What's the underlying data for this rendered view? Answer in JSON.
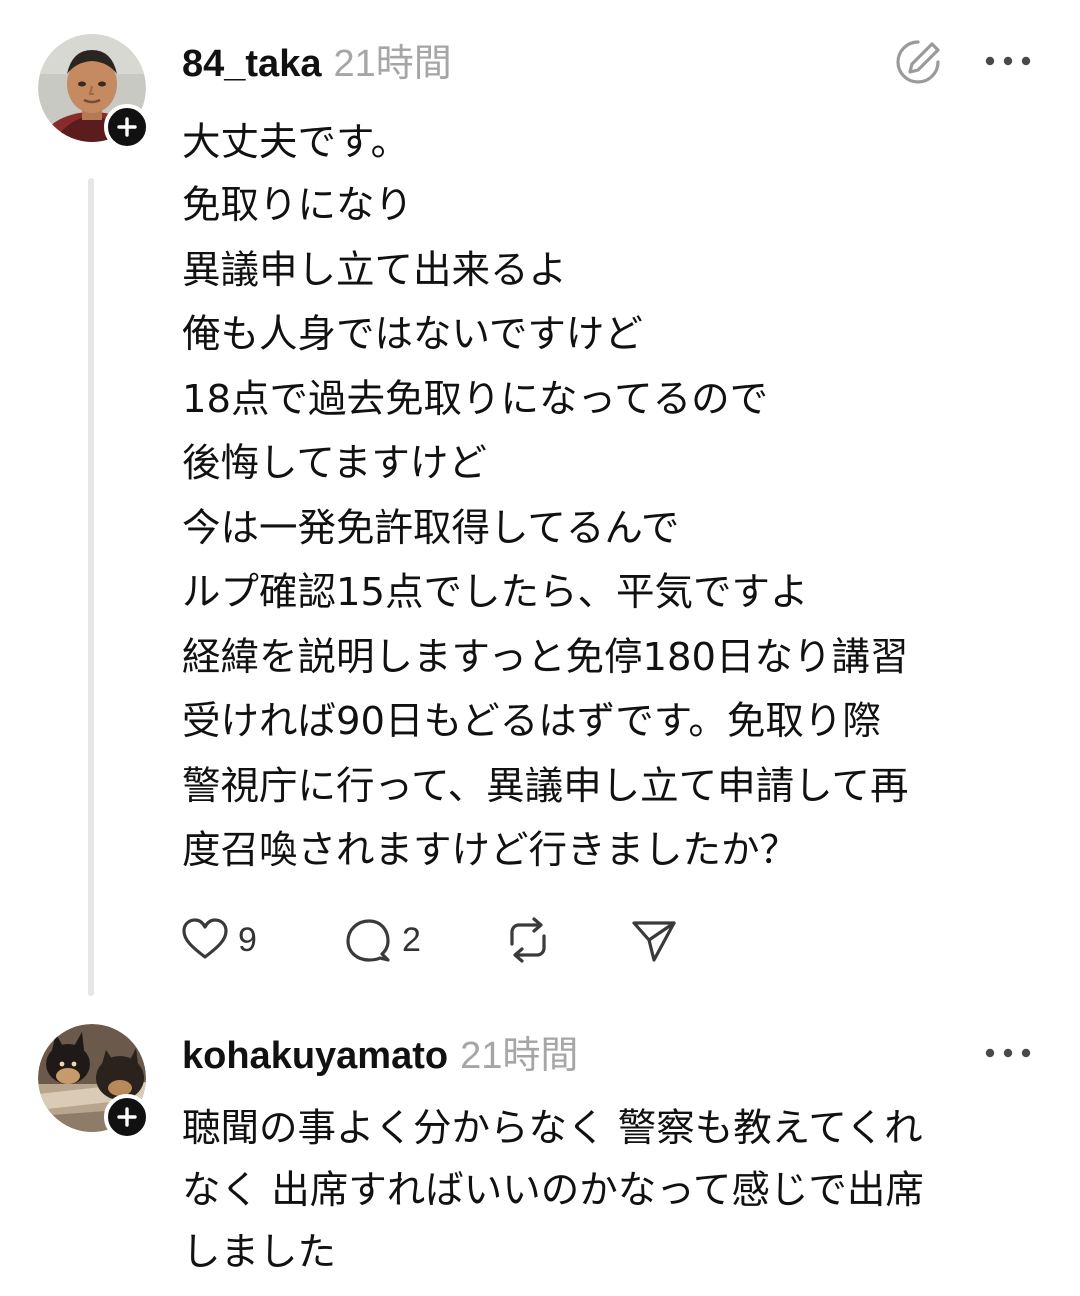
{
  "posts": [
    {
      "username": "84_taka",
      "timestamp": "21時間",
      "body_lines": [
        "大丈夫です。",
        "免取りになり",
        "異議申し立て出来るよ",
        "俺も人身ではないですけど",
        "18点で過去免取りになってるので",
        "後悔してますけど",
        "今は一発免許取得してるんで",
        "ルプ確認15点でしたら、平気ですよ",
        "経緯を説明しますっと免停180日なり講習",
        "受ければ90日もどるはずです。免取り際",
        "警視庁に行って、異議申し立て申請して再",
        "度召喚されますけど行きましたか？"
      ],
      "actions": {
        "like_count": "9",
        "reply_count": "2"
      },
      "icons": [
        "user-avatar",
        "plus-icon",
        "edit-icon",
        "more-icon",
        "heart-icon",
        "comment-icon",
        "repost-icon",
        "send-icon"
      ]
    },
    {
      "username": "kohakuyamato",
      "timestamp": "21時間",
      "body_lines": [
        "聴聞の事よく分からなく 警察も教えてくれ",
        "なく 出席すればいいのかなって感じで出席",
        "しました"
      ],
      "icons": [
        "user-avatar",
        "plus-icon",
        "more-icon"
      ]
    }
  ],
  "colors": {
    "text": "#111111",
    "muted": "#a6a6a6",
    "thread_line": "#e6e6e6",
    "icon": "#3a3a3a"
  }
}
